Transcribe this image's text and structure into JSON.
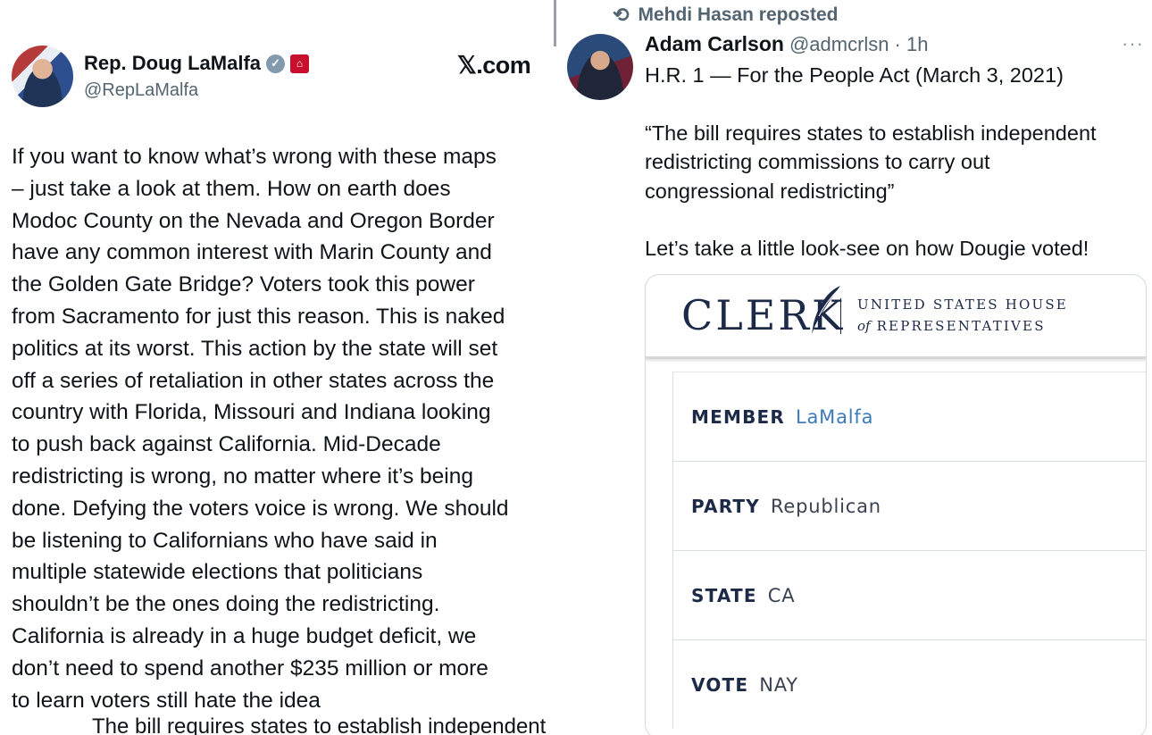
{
  "left_tweet": {
    "author_name": "Rep. Doug LaMalfa",
    "handle": "@RepLaMalfa",
    "source": "𝕏.com",
    "verified_icon": "verified-badge-icon",
    "affiliation_icon": "us-capitol-icon",
    "lines": [
      "If you want to know what’s wrong with these maps",
      "– just take a look at them.  How on earth does",
      "Modoc County on the Nevada and Oregon Border",
      "have any common interest with Marin County and",
      "the Golden Gate Bridge?    Voters took this power",
      "from Sacramento for just this reason. This is naked",
      "politics at its worst.  This action by the state will set",
      "off a series of retaliation in other states across the",
      "country with Florida, Missouri and Indiana looking",
      "to push back against California. Mid-Decade",
      "redistricting is wrong, no matter where it’s being",
      "done.  Defying the voters voice is wrong. We should",
      "be listening to Californians who have said in",
      "multiple statewide elections that politicians",
      "shouldn’t be the ones doing the redistricting.",
      "California is already in a huge budget deficit, we",
      "don’t need to spend another $235 million or more",
      "to learn voters still hate the idea"
    ],
    "cutoff_text": "The bill requires states to establish independent"
  },
  "right_tweet": {
    "repost_label": "Mehdi Hasan reposted",
    "repost_icon": "repost-icon",
    "author_name": "Adam Carlson",
    "handle": "@admcrlsn",
    "time": "· 1h",
    "more_label": "···",
    "paragraphs": [
      [
        "H.R. 1 — For the People Act (March 3, 2021)"
      ],
      [
        "“The bill requires states to establish independent",
        "redistricting commissions to carry out",
        "congressional redistricting”"
      ],
      [
        "Let’s take a little look-see on how Dougie voted!"
      ]
    ],
    "card": {
      "logo_word": "CLERK",
      "logo_line1": "UNITED STATES HOUSE",
      "logo_of": "of",
      "logo_line2": "REPRESENTATIVES",
      "rows": [
        {
          "label": "MEMBER",
          "value": "LaMalfa"
        },
        {
          "label": "PARTY",
          "value": "Republican"
        },
        {
          "label": "STATE",
          "value": "CA"
        },
        {
          "label": "VOTE",
          "value": "NAY"
        }
      ]
    }
  },
  "colors": {
    "text": "#0f1419",
    "muted": "#536471",
    "clerk_navy": "#1c2a48",
    "link_blue": "#3d7ab8",
    "gov_red": "#c8102e"
  }
}
